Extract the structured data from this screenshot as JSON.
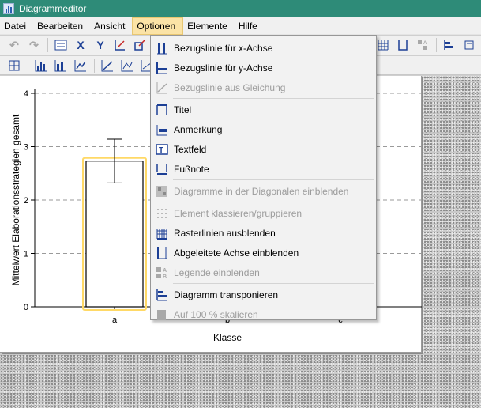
{
  "window": {
    "title": "Diagrammeditor"
  },
  "menubar": [
    {
      "label": "Datei",
      "active": false
    },
    {
      "label": "Bearbeiten",
      "active": false
    },
    {
      "label": "Ansicht",
      "active": false
    },
    {
      "label": "Optionen",
      "active": true
    },
    {
      "label": "Elemente",
      "active": false
    },
    {
      "label": "Hilfe",
      "active": false
    }
  ],
  "toolbar1": {
    "glyphs": {
      "x_axis": "X",
      "y_axis": "Y"
    }
  },
  "dropdown": {
    "menu": "Optionen",
    "items": [
      {
        "label": "Bezugslinie für x-Achse",
        "enabled": true,
        "icon": "x-reference-line-icon"
      },
      {
        "label": "Bezugslinie für y-Achse",
        "enabled": true,
        "icon": "y-reference-line-icon"
      },
      {
        "label": "Bezugslinie aus Gleichung",
        "enabled": false,
        "icon": "equation-line-icon"
      },
      {
        "separator": true
      },
      {
        "label": "Titel",
        "enabled": true,
        "icon": "title-icon"
      },
      {
        "label": "Anmerkung",
        "enabled": true,
        "icon": "annotation-icon"
      },
      {
        "label": "Textfeld",
        "enabled": true,
        "icon": "textbox-icon"
      },
      {
        "label": "Fußnote",
        "enabled": true,
        "icon": "footnote-icon"
      },
      {
        "separator": true
      },
      {
        "label": "Diagramme in der Diagonalen einblenden",
        "enabled": false,
        "icon": "diagonal-charts-icon"
      },
      {
        "separator": true
      },
      {
        "label": "Element klassieren/gruppieren",
        "enabled": false,
        "icon": "bin-group-icon"
      },
      {
        "label": "Rasterlinien ausblenden",
        "enabled": true,
        "icon": "gridlines-icon"
      },
      {
        "label": "Abgeleitete Achse einblenden",
        "enabled": true,
        "icon": "derived-axis-icon"
      },
      {
        "label": "Legende einblenden",
        "enabled": false,
        "icon": "legend-icon"
      },
      {
        "separator": true
      },
      {
        "label": "Diagramm transponieren",
        "enabled": true,
        "icon": "transpose-icon"
      },
      {
        "label": "Auf 100 % skalieren",
        "enabled": false,
        "icon": "scale-100-icon"
      }
    ]
  },
  "colors": {
    "titlebar": "#2e8b78",
    "menu_highlight": "#fbe3a6",
    "icon_blue": "#1c3f95",
    "bar_highlight": "#ffd966"
  },
  "chart_data": {
    "type": "bar",
    "categories": [
      "a",
      "b",
      "c"
    ],
    "visible_values": {
      "a": 2.73
    },
    "error_bars": {
      "a": [
        2.32,
        3.14
      ]
    },
    "ylabel": "Mittelwert Elaborationsstrategien gesamt",
    "xlabel": "Klasse",
    "ylim": [
      0,
      4
    ],
    "yticks": [
      "0",
      "1",
      "2",
      "3",
      "4"
    ],
    "grid": true
  }
}
